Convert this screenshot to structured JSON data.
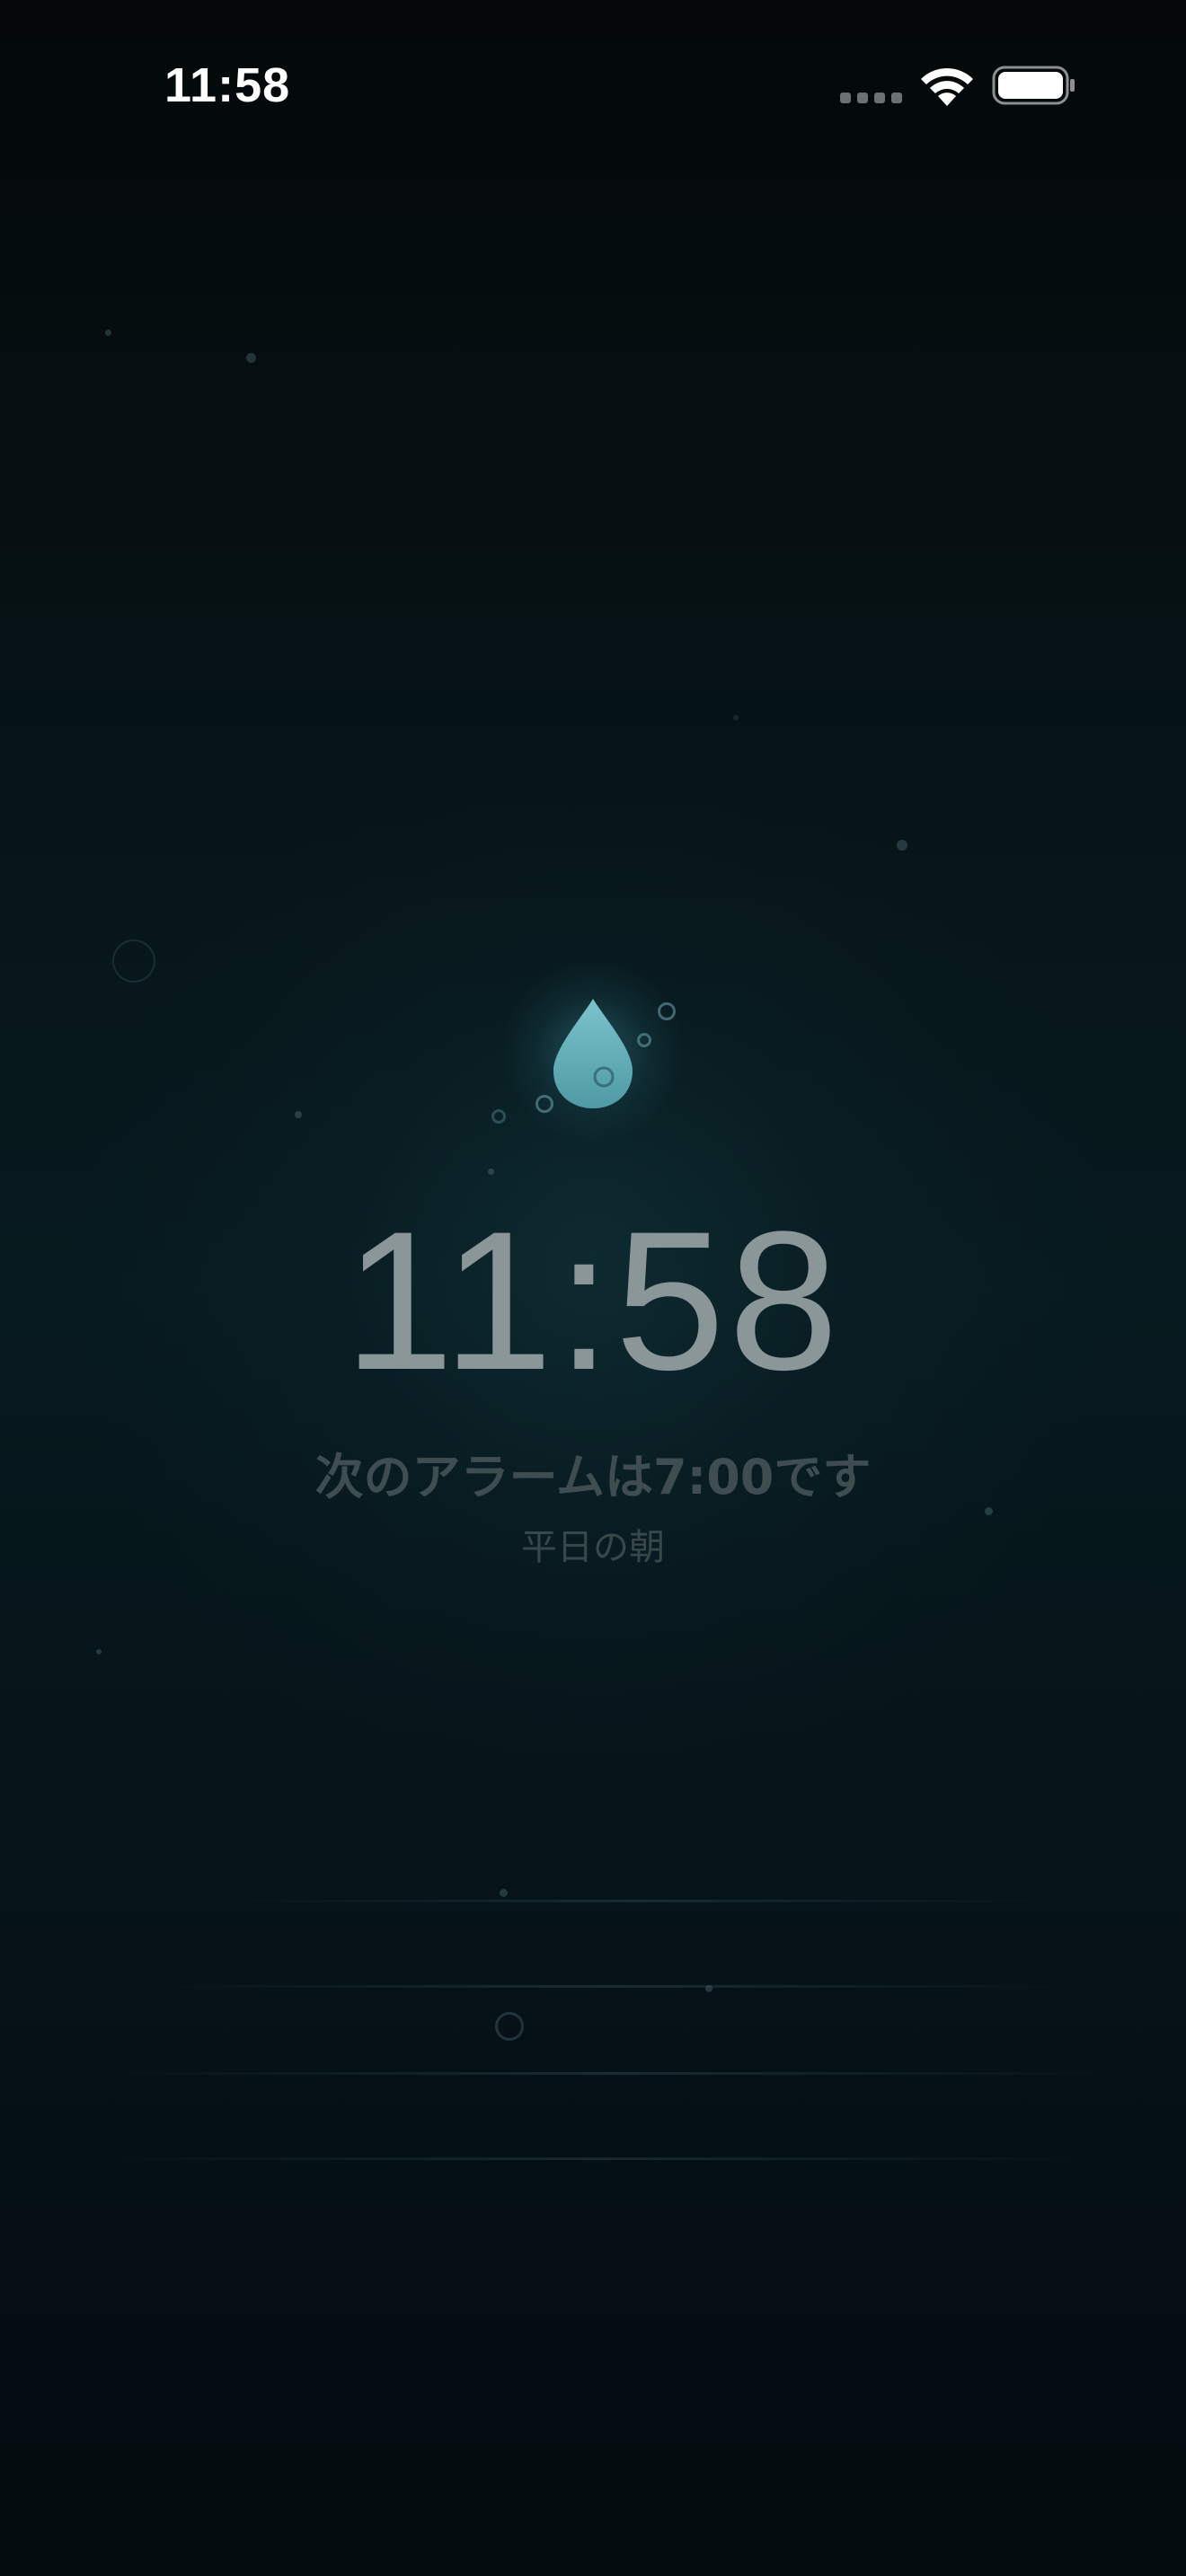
{
  "status_bar": {
    "time": "11:58",
    "icons": [
      "cellular-signal-icon",
      "wifi-icon",
      "battery-icon"
    ]
  },
  "main": {
    "icon": "water-drop-icon",
    "clock": "11:58",
    "next_alarm_text": "次のアラームは7:00です",
    "alarm_label": "平日の朝"
  },
  "colors": {
    "background": "#06151a",
    "drop": "#5fa9b3",
    "clock_text": "#8a9698",
    "subtitle_text": "#3f4d50"
  }
}
